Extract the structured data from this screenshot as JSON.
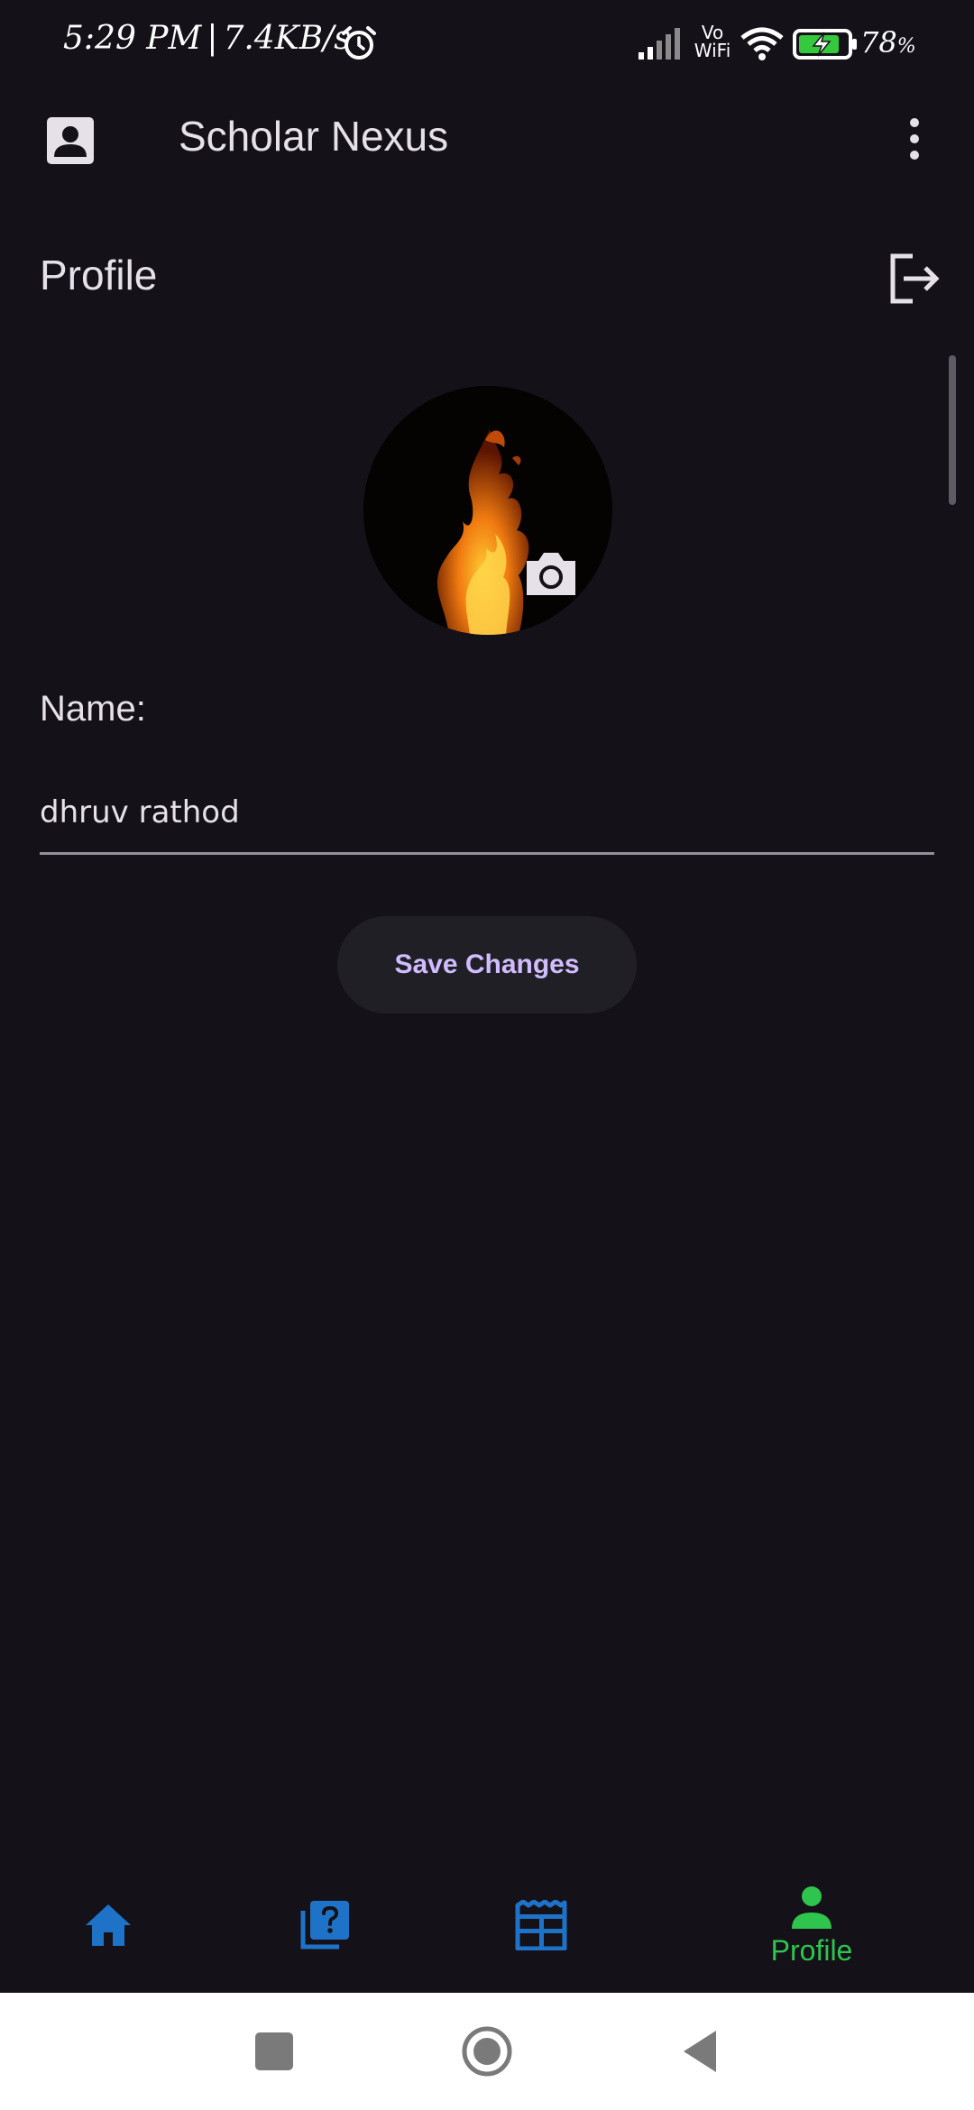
{
  "status_bar": {
    "time": "5:29 PM",
    "separator": "|",
    "net_speed": "7.4KB/s",
    "vowifi_line1": "Vo",
    "vowifi_line2": "WiFi",
    "battery_level": "78",
    "battery_unit": "%"
  },
  "app_bar": {
    "title": "Scholar Nexus",
    "leading_icon": "account-box-icon",
    "menu_icon": "more-vert-icon"
  },
  "page": {
    "title": "Profile",
    "logout_icon": "logout-icon"
  },
  "profile": {
    "photo_desc_icon": "camera-icon",
    "name_label": "Name:",
    "name_value": "dhruv rathod",
    "save_label": "Save Changes"
  },
  "bottom_nav": {
    "items": [
      {
        "icon": "home-icon",
        "label": ""
      },
      {
        "icon": "quiz-icon",
        "label": ""
      },
      {
        "icon": "newspaper-icon",
        "label": ""
      },
      {
        "icon": "person-icon",
        "label": "Profile",
        "active": true
      }
    ]
  },
  "colors": {
    "background": "#141218",
    "nav_inactive": "#1e73c8",
    "nav_active": "#2ec44e",
    "button_text": "#d0bcff"
  }
}
